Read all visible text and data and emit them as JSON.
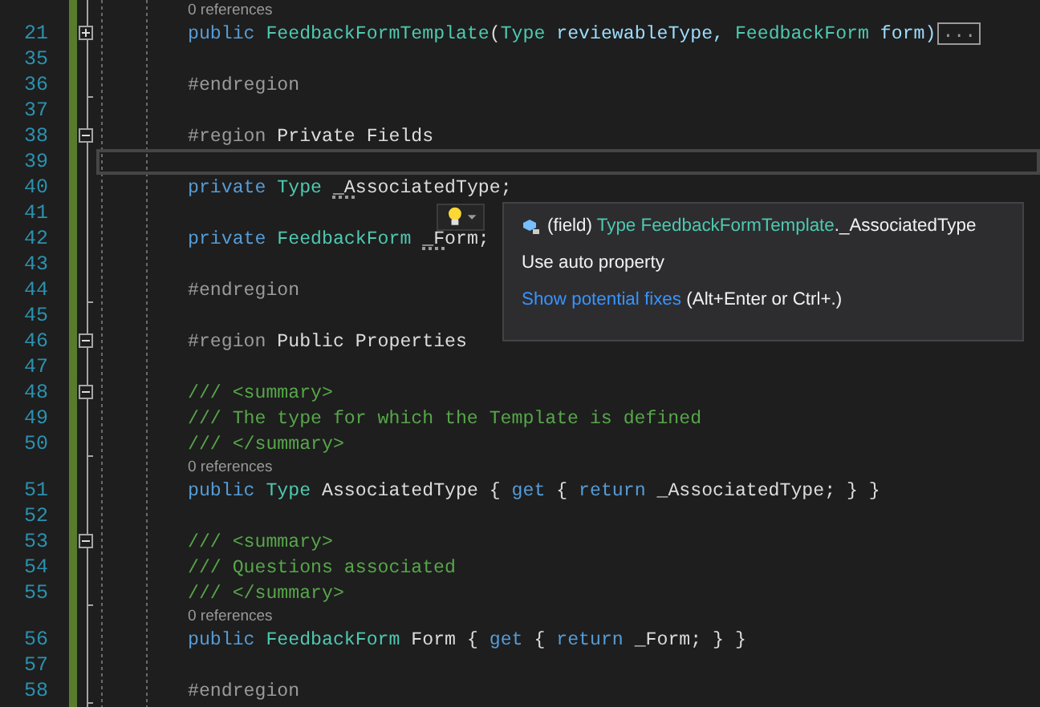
{
  "editor": {
    "lines": [
      {
        "number": "21",
        "lens": "0 references",
        "kind": "fold-start",
        "expanded": false,
        "current": false,
        "tokens": [
          {
            "kind": "keyword",
            "text": "public "
          },
          {
            "kind": "type",
            "text": "FeedbackFormTemplate"
          },
          {
            "kind": "plain",
            "text": "("
          },
          {
            "kind": "type",
            "text": "Type"
          },
          {
            "kind": "ident",
            "text": " reviewableType, "
          },
          {
            "kind": "type",
            "text": "FeedbackForm"
          },
          {
            "kind": "ident",
            "text": " form)"
          }
        ],
        "collapsed_text": "..."
      },
      {
        "number": "35",
        "kind": "plain",
        "current": false
      },
      {
        "number": "36",
        "kind": "fold-end",
        "current": false,
        "tokens": [
          {
            "kind": "directive",
            "text": "#endregion"
          }
        ]
      },
      {
        "number": "37",
        "kind": "plain",
        "current": false
      },
      {
        "number": "38",
        "kind": "fold-start",
        "expanded": true,
        "current": false,
        "tokens": [
          {
            "kind": "directive",
            "text": "#region "
          },
          {
            "kind": "plain",
            "text": "Private Fields"
          }
        ]
      },
      {
        "number": "39",
        "kind": "plain",
        "current": true
      },
      {
        "number": "40",
        "kind": "plain",
        "current": false,
        "tokens": [
          {
            "kind": "keyword",
            "text": "private "
          },
          {
            "kind": "type",
            "text": "Type "
          },
          {
            "kind": "hinted",
            "text": "_AssociatedType"
          },
          {
            "kind": "plain",
            "text": ";"
          }
        ]
      },
      {
        "number": "41",
        "kind": "plain",
        "current": false
      },
      {
        "number": "42",
        "kind": "plain",
        "current": false,
        "tokens": [
          {
            "kind": "keyword",
            "text": "private "
          },
          {
            "kind": "type",
            "text": "FeedbackForm "
          },
          {
            "kind": "hinted",
            "text": "_Form"
          },
          {
            "kind": "plain",
            "text": ";"
          }
        ]
      },
      {
        "number": "43",
        "kind": "plain",
        "current": false
      },
      {
        "number": "44",
        "kind": "fold-end",
        "current": false,
        "tokens": [
          {
            "kind": "directive",
            "text": "#endregion"
          }
        ]
      },
      {
        "number": "45",
        "kind": "plain",
        "current": false
      },
      {
        "number": "46",
        "kind": "fold-start",
        "expanded": true,
        "current": false,
        "tokens": [
          {
            "kind": "directive",
            "text": "#region "
          },
          {
            "kind": "plain",
            "text": "Public Properties"
          }
        ]
      },
      {
        "number": "47",
        "kind": "plain",
        "current": false
      },
      {
        "number": "48",
        "kind": "fold-start",
        "expanded": true,
        "current": false,
        "tokens": [
          {
            "kind": "comment",
            "text": "/// <summary>"
          }
        ]
      },
      {
        "number": "49",
        "kind": "plain",
        "current": false,
        "tokens": [
          {
            "kind": "comment",
            "text": "/// The type for which the Template is defined"
          }
        ]
      },
      {
        "number": "50",
        "kind": "fold-end",
        "current": false,
        "tokens": [
          {
            "kind": "comment",
            "text": "/// </summary>"
          }
        ]
      },
      {
        "number": "51",
        "lens": "0 references",
        "kind": "plain",
        "current": false,
        "tokens": [
          {
            "kind": "keyword",
            "text": "public "
          },
          {
            "kind": "type",
            "text": "Type"
          },
          {
            "kind": "plain",
            "text": " AssociatedType { "
          },
          {
            "kind": "keyword",
            "text": "get"
          },
          {
            "kind": "plain",
            "text": " { "
          },
          {
            "kind": "keyword",
            "text": "return"
          },
          {
            "kind": "plain",
            "text": " _AssociatedType; } }"
          }
        ]
      },
      {
        "number": "52",
        "kind": "plain",
        "current": false
      },
      {
        "number": "53",
        "kind": "fold-start",
        "expanded": true,
        "current": false,
        "tokens": [
          {
            "kind": "comment",
            "text": "/// <summary>"
          }
        ]
      },
      {
        "number": "54",
        "kind": "plain",
        "current": false,
        "tokens": [
          {
            "kind": "comment",
            "text": "/// Questions associated"
          }
        ]
      },
      {
        "number": "55",
        "kind": "fold-end",
        "current": false,
        "tokens": [
          {
            "kind": "comment",
            "text": "/// </summary>"
          }
        ]
      },
      {
        "number": "56",
        "lens": "0 references",
        "kind": "plain",
        "current": false,
        "tokens": [
          {
            "kind": "keyword",
            "text": "public "
          },
          {
            "kind": "type",
            "text": "FeedbackForm"
          },
          {
            "kind": "plain",
            "text": " Form { "
          },
          {
            "kind": "keyword",
            "text": "get"
          },
          {
            "kind": "plain",
            "text": " { "
          },
          {
            "kind": "keyword",
            "text": "return"
          },
          {
            "kind": "plain",
            "text": " _Form; } }"
          }
        ]
      },
      {
        "number": "57",
        "kind": "plain",
        "current": false
      },
      {
        "number": "58",
        "kind": "fold-end",
        "current": false,
        "tokens": [
          {
            "kind": "directive",
            "text": "#endregion"
          }
        ]
      }
    ]
  },
  "quick_info": {
    "signature": [
      {
        "kind": "plain",
        "text": "(field) "
      },
      {
        "kind": "type",
        "text": "Type FeedbackFormTemplate"
      },
      {
        "kind": "plain",
        "text": "._AssociatedType"
      }
    ],
    "suggestion": "Use auto property",
    "link": "Show potential fixes",
    "shortcut": "(Alt+Enter or Ctrl+.)"
  }
}
